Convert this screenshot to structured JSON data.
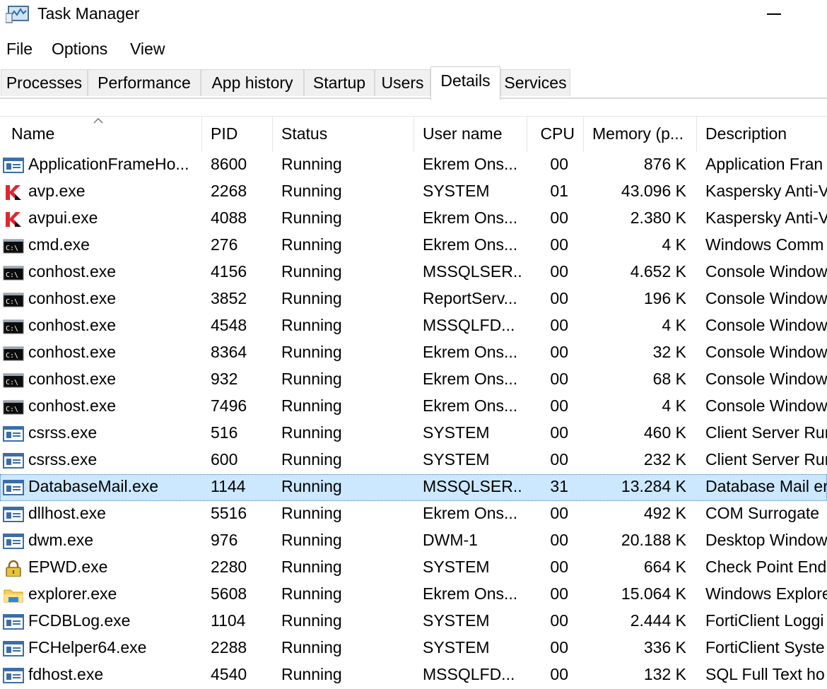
{
  "window": {
    "title": "Task Manager"
  },
  "menu": [
    "File",
    "Options",
    "View"
  ],
  "tabs": [
    "Processes",
    "Performance",
    "App history",
    "Startup",
    "Users",
    "Details",
    "Services"
  ],
  "active_tab": "Details",
  "columns": [
    "Name",
    "PID",
    "Status",
    "User name",
    "CPU",
    "Memory (p...",
    "Description"
  ],
  "selected_row": 12,
  "colors": {
    "selection": "#cce8ff",
    "kaspersky_red": "#e0262f",
    "header_border": "#e5e5e5"
  },
  "rows": [
    {
      "icon": "window-app-icon",
      "name": "ApplicationFrameHo...",
      "pid": "8600",
      "status": "Running",
      "user": "Ekrem Ons...",
      "cpu": "00",
      "memory": "876 K",
      "description": "Application Fran"
    },
    {
      "icon": "kaspersky-icon",
      "name": "avp.exe",
      "pid": "2268",
      "status": "Running",
      "user": "SYSTEM",
      "cpu": "01",
      "memory": "43.096 K",
      "description": "Kaspersky Anti-V"
    },
    {
      "icon": "kaspersky-icon",
      "name": "avpui.exe",
      "pid": "4088",
      "status": "Running",
      "user": "Ekrem Ons...",
      "cpu": "00",
      "memory": "2.380 K",
      "description": "Kaspersky Anti-V"
    },
    {
      "icon": "console-icon",
      "name": "cmd.exe",
      "pid": "276",
      "status": "Running",
      "user": "Ekrem Ons...",
      "cpu": "00",
      "memory": "4 K",
      "description": "Windows Comm"
    },
    {
      "icon": "console-icon",
      "name": "conhost.exe",
      "pid": "4156",
      "status": "Running",
      "user": "MSSQLSER...",
      "cpu": "00",
      "memory": "4.652 K",
      "description": "Console Window"
    },
    {
      "icon": "console-icon",
      "name": "conhost.exe",
      "pid": "3852",
      "status": "Running",
      "user": "ReportServ...",
      "cpu": "00",
      "memory": "196 K",
      "description": "Console Window"
    },
    {
      "icon": "console-icon",
      "name": "conhost.exe",
      "pid": "4548",
      "status": "Running",
      "user": "MSSQLFD...",
      "cpu": "00",
      "memory": "4 K",
      "description": "Console Window"
    },
    {
      "icon": "console-icon",
      "name": "conhost.exe",
      "pid": "8364",
      "status": "Running",
      "user": "Ekrem Ons...",
      "cpu": "00",
      "memory": "32 K",
      "description": "Console Window"
    },
    {
      "icon": "console-icon",
      "name": "conhost.exe",
      "pid": "932",
      "status": "Running",
      "user": "Ekrem Ons...",
      "cpu": "00",
      "memory": "68 K",
      "description": "Console Window"
    },
    {
      "icon": "console-icon",
      "name": "conhost.exe",
      "pid": "7496",
      "status": "Running",
      "user": "Ekrem Ons...",
      "cpu": "00",
      "memory": "4 K",
      "description": "Console Window"
    },
    {
      "icon": "window-app-icon",
      "name": "csrss.exe",
      "pid": "516",
      "status": "Running",
      "user": "SYSTEM",
      "cpu": "00",
      "memory": "460 K",
      "description": "Client Server Rur"
    },
    {
      "icon": "window-app-icon",
      "name": "csrss.exe",
      "pid": "600",
      "status": "Running",
      "user": "SYSTEM",
      "cpu": "00",
      "memory": "232 K",
      "description": "Client Server Rur"
    },
    {
      "icon": "window-app-icon",
      "name": "DatabaseMail.exe",
      "pid": "1144",
      "status": "Running",
      "user": "MSSQLSER...",
      "cpu": "31",
      "memory": "13.284 K",
      "description": "Database Mail er"
    },
    {
      "icon": "window-app-icon",
      "name": "dllhost.exe",
      "pid": "5516",
      "status": "Running",
      "user": "Ekrem Ons...",
      "cpu": "00",
      "memory": "492 K",
      "description": "COM Surrogate"
    },
    {
      "icon": "window-app-icon",
      "name": "dwm.exe",
      "pid": "976",
      "status": "Running",
      "user": "DWM-1",
      "cpu": "00",
      "memory": "20.188 K",
      "description": "Desktop Window"
    },
    {
      "icon": "padlock-icon",
      "name": "EPWD.exe",
      "pid": "2280",
      "status": "Running",
      "user": "SYSTEM",
      "cpu": "00",
      "memory": "664 K",
      "description": "Check Point End"
    },
    {
      "icon": "folder-icon",
      "name": "explorer.exe",
      "pid": "5608",
      "status": "Running",
      "user": "Ekrem Ons...",
      "cpu": "00",
      "memory": "15.064 K",
      "description": "Windows Explore"
    },
    {
      "icon": "window-app-icon",
      "name": "FCDBLog.exe",
      "pid": "1104",
      "status": "Running",
      "user": "SYSTEM",
      "cpu": "00",
      "memory": "2.444 K",
      "description": "FortiClient Loggi"
    },
    {
      "icon": "window-app-icon",
      "name": "FCHelper64.exe",
      "pid": "2288",
      "status": "Running",
      "user": "SYSTEM",
      "cpu": "00",
      "memory": "336 K",
      "description": "FortiClient Syste"
    },
    {
      "icon": "window-app-icon",
      "name": "fdhost.exe",
      "pid": "4540",
      "status": "Running",
      "user": "MSSQLFD...",
      "cpu": "00",
      "memory": "132 K",
      "description": "SQL Full Text ho"
    }
  ]
}
